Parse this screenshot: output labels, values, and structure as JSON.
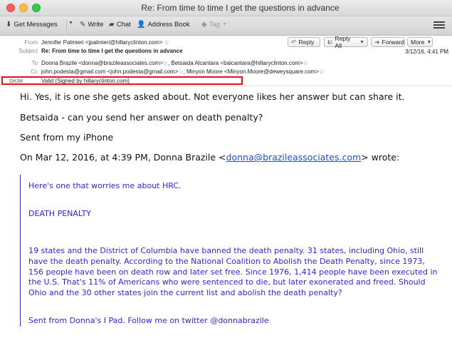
{
  "window": {
    "title": "Re: From time to time I get the questions in advance"
  },
  "toolbar": {
    "get_messages": "Get Messages",
    "write": "Write",
    "chat": "Chat",
    "address_book": "Address Book",
    "tag": "Tag"
  },
  "header": {
    "from_label": "From",
    "from_value": "Jennifer Palmieri <jpalmieri@hillaryclinton.com>",
    "subject_label": "Subject",
    "subject_value": "Re: From time to time I get the questions in advance",
    "to_label": "To",
    "to_value_1": "Donna Brazile <donna@brazileassociates.com>",
    "to_value_2": "Betsaida Alcantara <balcantara@hillaryclinton.com>",
    "cc_label": "Cc",
    "cc_value_1": "john.podesta@gmail.com <john.podesta@gmail.com>",
    "cc_value_2": "Minyon Moore <Minyon.Moore@deweysquare.com>",
    "dkim_label": "DKIM",
    "dkim_value": "Valid (Signed by hillaryclinton.com)",
    "date": "3/12/16, 4:41 PM",
    "reply": "Reply",
    "reply_all": "Reply All",
    "forward": "Forward",
    "more": "More"
  },
  "body": {
    "line1": "Hi.  Yes, it is one she gets asked about.  Not everyone likes her answer but can share it.",
    "line2": "Betsaida - can you send her answer on death penalty?",
    "line3": "Sent from my iPhone",
    "attribution_pre": "On Mar 12, 2016, at 4:39 PM, Donna Brazile <",
    "attribution_link": "donna@brazileassociates.com",
    "attribution_post": "> wrote:",
    "quote1": "Here's one that worries me about HRC.",
    "quote2": "DEATH PENALTY",
    "quote3": "19 states and the District of Columbia have banned the death penalty. 31 states, including Ohio, still have the death penalty. According to the National Coalition to Abolish the Death Penalty, since 1973, 156 people have been on death row and later set free. Since 1976, 1,414 people have been executed in the U.S. That's 11% of Americans who were sentenced to die, but later exonerated and freed. Should Ohio and the 30 other states join the current list and abolish the death penalty?",
    "quote4": "Sent from Donna's I Pad. Follow me on twitter @donnabrazile"
  },
  "colors": {
    "quote_text": "#2f26d6",
    "highlight_box": "#e8101a",
    "link": "#1a4fd6"
  }
}
